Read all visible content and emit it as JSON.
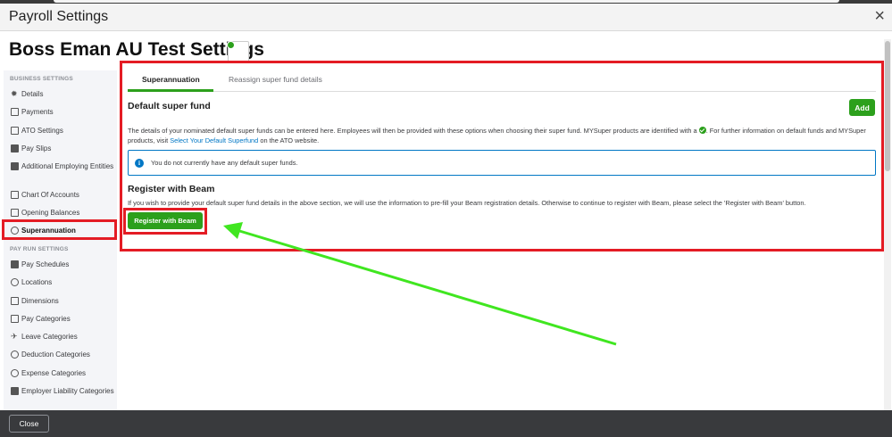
{
  "window": {
    "title": "Payroll Settings",
    "close_glyph": "×"
  },
  "page": {
    "heading": "Boss Eman AU Test Settings"
  },
  "sidebar": {
    "business_section": "BUSINESS SETTINGS",
    "business_items": [
      {
        "label": "Details",
        "icon": "gear-icon"
      },
      {
        "label": "Payments",
        "icon": "payments-icon"
      },
      {
        "label": "ATO Settings",
        "icon": "ato-icon"
      },
      {
        "label": "Pay Slips",
        "icon": "payslip-icon"
      },
      {
        "label": "Additional Employing Entities",
        "icon": "building-icon"
      },
      {
        "label": "Chart Of Accounts",
        "icon": "list-icon"
      },
      {
        "label": "Opening Balances",
        "icon": "balance-icon"
      },
      {
        "label": "Superannuation",
        "icon": "super-icon",
        "active": true
      }
    ],
    "payrun_section": "PAY RUN SETTINGS",
    "payrun_items": [
      {
        "label": "Pay Schedules",
        "icon": "schedule-icon"
      },
      {
        "label": "Locations",
        "icon": "location-icon"
      },
      {
        "label": "Dimensions",
        "icon": "dimensions-icon"
      },
      {
        "label": "Pay Categories",
        "icon": "pay-categories-icon"
      },
      {
        "label": "Leave Categories",
        "icon": "plane-icon"
      },
      {
        "label": "Deduction Categories",
        "icon": "deduction-icon"
      },
      {
        "label": "Expense Categories",
        "icon": "expense-icon"
      },
      {
        "label": "Employer Liability Categories",
        "icon": "liability-icon"
      }
    ]
  },
  "tabs": [
    {
      "label": "Superannuation",
      "active": true
    },
    {
      "label": "Reassign super fund details",
      "active": false
    }
  ],
  "default_fund": {
    "title": "Default super fund",
    "add_label": "Add",
    "desc_part1": "The details of your nominated default super funds can be entered here. Employees will then be provided with these options when choosing their super fund. MYSuper products are identified with a",
    "desc_part2": ". For further information on default funds and MYSuper products, visit",
    "link_text": "Select Your Default Superfund",
    "desc_part3": "on the ATO website.",
    "info_text": "You do not currently have any default super funds."
  },
  "beam": {
    "title": "Register with Beam",
    "desc": "If you wish to provide your default super fund details in the above section, we will use the information to pre-fill your Beam registration details. Otherwise to continue to register with Beam, please select the 'Register with Beam' button.",
    "button_label": "Register with Beam"
  },
  "footer": {
    "close_label": "Close"
  },
  "colors": {
    "accent_green": "#2ca01c",
    "annotation_red": "#e41c24",
    "annotation_arrow": "#40e620",
    "link_blue": "#0077c5",
    "footer_bg": "#393a3d"
  }
}
